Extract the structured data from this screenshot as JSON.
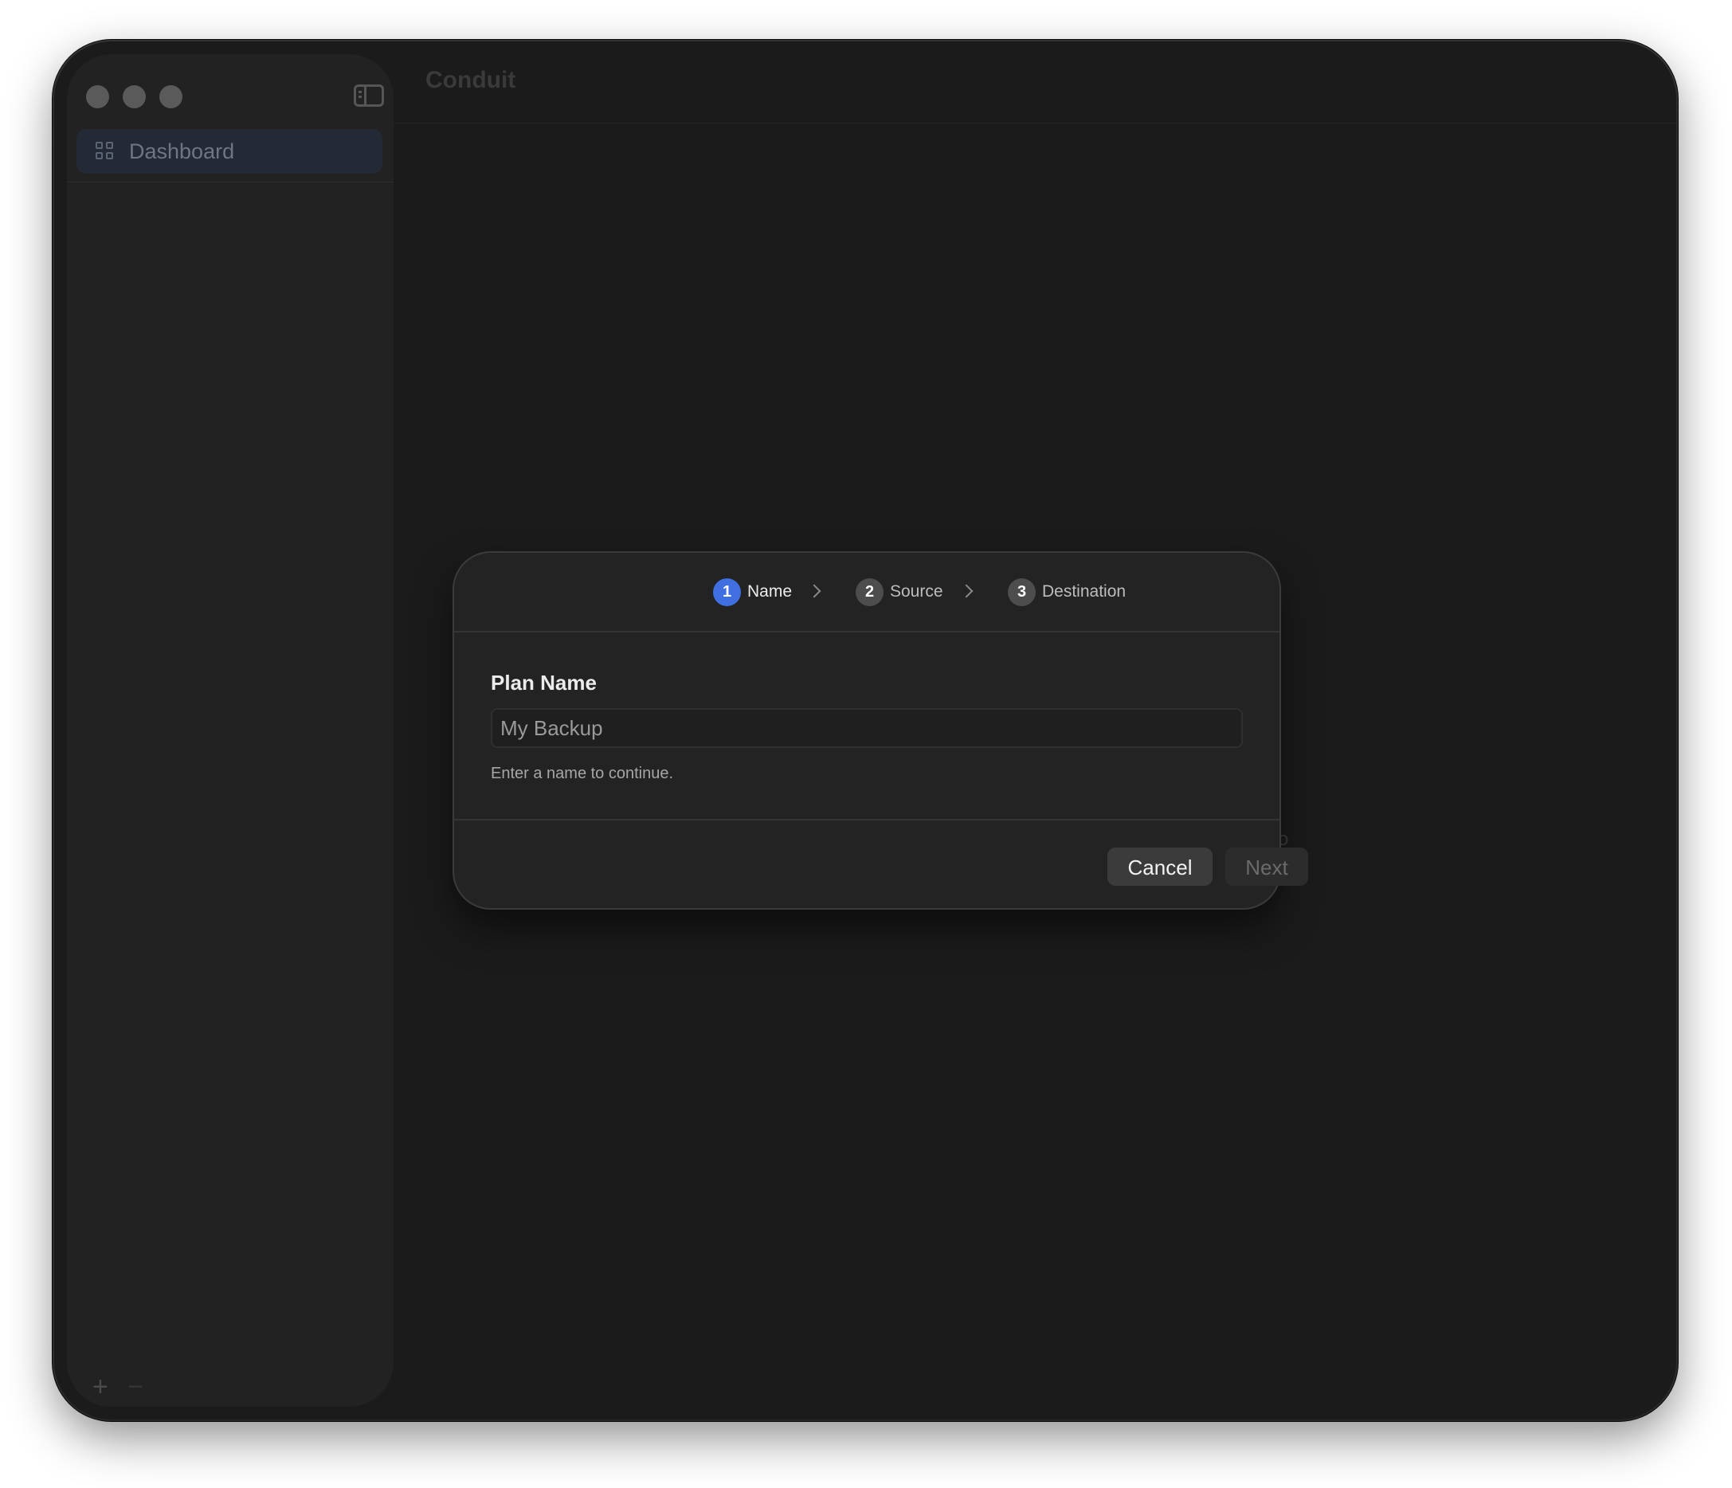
{
  "app": {
    "title": "Conduit"
  },
  "sidebar": {
    "items": [
      {
        "label": "Dashboard",
        "icon": "grid-icon"
      }
    ],
    "add_label": "+",
    "remove_label": "−"
  },
  "main": {
    "stray_glyph": "o"
  },
  "dialog": {
    "steps": [
      {
        "number": "1",
        "label": "Name",
        "state": "active",
        "color": "#3f6fe0"
      },
      {
        "number": "2",
        "label": "Source",
        "state": "inactive",
        "color": "#4d4d4d"
      },
      {
        "number": "3",
        "label": "Destination",
        "state": "inactive",
        "color": "#4d4d4d"
      }
    ],
    "field_label": "Plan Name",
    "field_placeholder": "My Backup",
    "field_value": "",
    "hint": "Enter a name to continue.",
    "cancel_label": "Cancel",
    "next_label": "Next",
    "next_enabled": false
  },
  "colors": {
    "window_bg": "#1b1b1b",
    "sidebar_bg": "#222222",
    "accent": "#3f6fe0",
    "dialog_bg": "#232323"
  }
}
